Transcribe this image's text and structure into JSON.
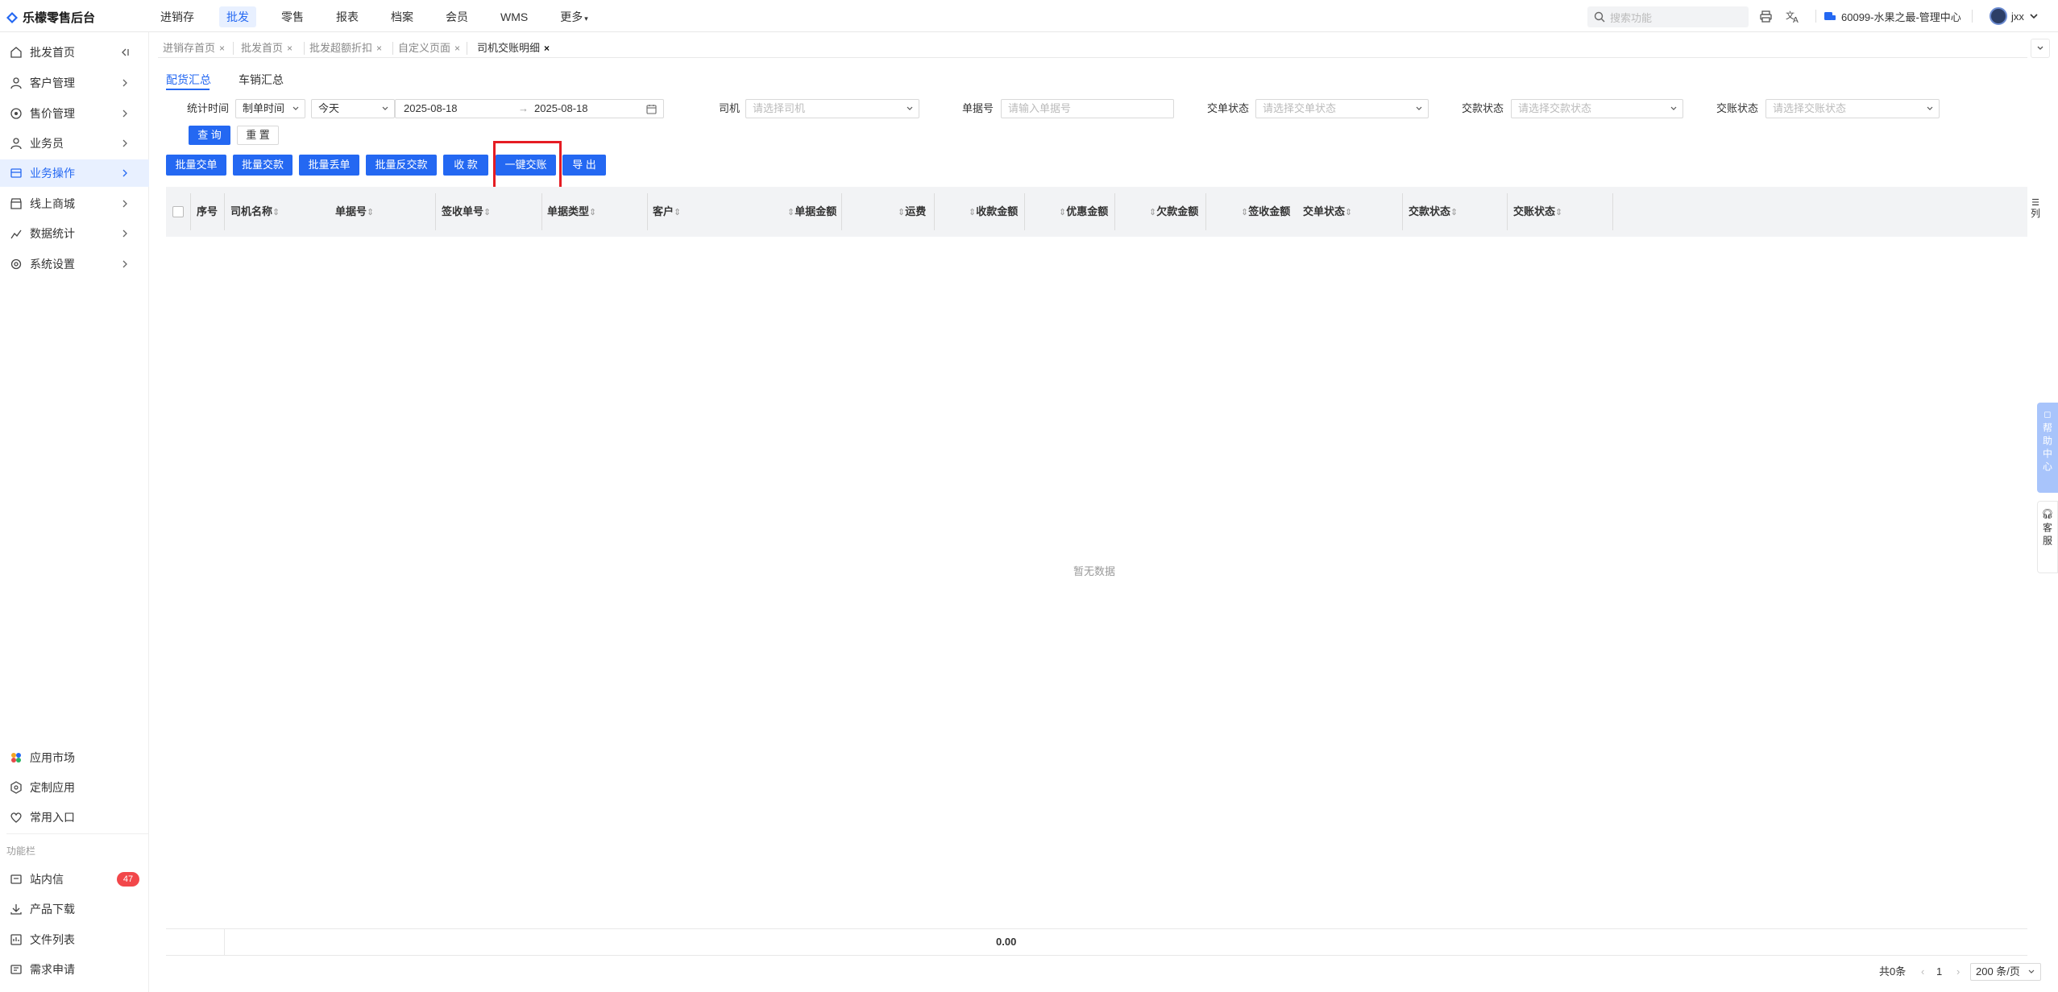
{
  "app": {
    "title": "乐檬零售后台"
  },
  "topnav": {
    "items": [
      "进销存",
      "批发",
      "零售",
      "报表",
      "档案",
      "会员",
      "WMS",
      "更多"
    ],
    "active": "批发"
  },
  "search": {
    "placeholder": "搜索功能"
  },
  "account": {
    "store": "60099-水果之最-管理中心",
    "user": "jxx"
  },
  "tabs": [
    "进销存首页",
    "批发首页",
    "批发超额折扣",
    "自定义页面",
    "司机交账明细"
  ],
  "sidebar": {
    "items": [
      "批发首页",
      "客户管理",
      "售价管理",
      "业务员",
      "业务操作",
      "线上商城",
      "数据统计",
      "系统设置"
    ],
    "active": "业务操作",
    "bottom_items": [
      "应用市场",
      "定制应用",
      "常用入口"
    ],
    "section_label": "功能栏",
    "func_items": [
      "站内信",
      "产品下载",
      "文件列表",
      "需求申请"
    ],
    "badge": "47"
  },
  "subtabs": [
    "配货汇总",
    "车销汇总"
  ],
  "filters": {
    "stat_time_label": "统计时间",
    "time_type": "制单时间",
    "range": "今天",
    "start_date": "2025-08-18",
    "end_date": "2025-08-18",
    "driver_label": "司机",
    "driver_placeholder": "请选择司机",
    "doc_no_label": "单据号",
    "doc_no_placeholder": "请输入单据号",
    "order_status_label": "交单状态",
    "order_status_placeholder": "请选择交单状态",
    "pay_status_label": "交款状态",
    "pay_status_placeholder": "请选择交款状态",
    "account_status_label": "交账状态",
    "account_status_placeholder": "请选择交账状态",
    "query": "查 询",
    "reset": "重 置"
  },
  "actions": [
    "批量交单",
    "批量交款",
    "批量丢单",
    "批量反交款",
    "收 款",
    "一键交账",
    "导 出"
  ],
  "table": {
    "columns": [
      "序号",
      "司机名称",
      "单据号",
      "签收单号",
      "单据类型",
      "客户",
      "单据金额",
      "运费",
      "收款金额",
      "优惠金额",
      "欠款金额",
      "签收金额",
      "交单状态",
      "交款状态",
      "交账状态"
    ],
    "empty_text": "暂无数据",
    "total": "0.00",
    "col_setting": "列"
  },
  "pagination": {
    "total": "共0条",
    "page": "1",
    "page_size": "200 条/页"
  },
  "right_tabs": {
    "help": "帮助中心",
    "service": "客服"
  },
  "colors": {
    "primary": "#2468f2",
    "highlight": "#e51c23",
    "badge": "#f2474a"
  }
}
